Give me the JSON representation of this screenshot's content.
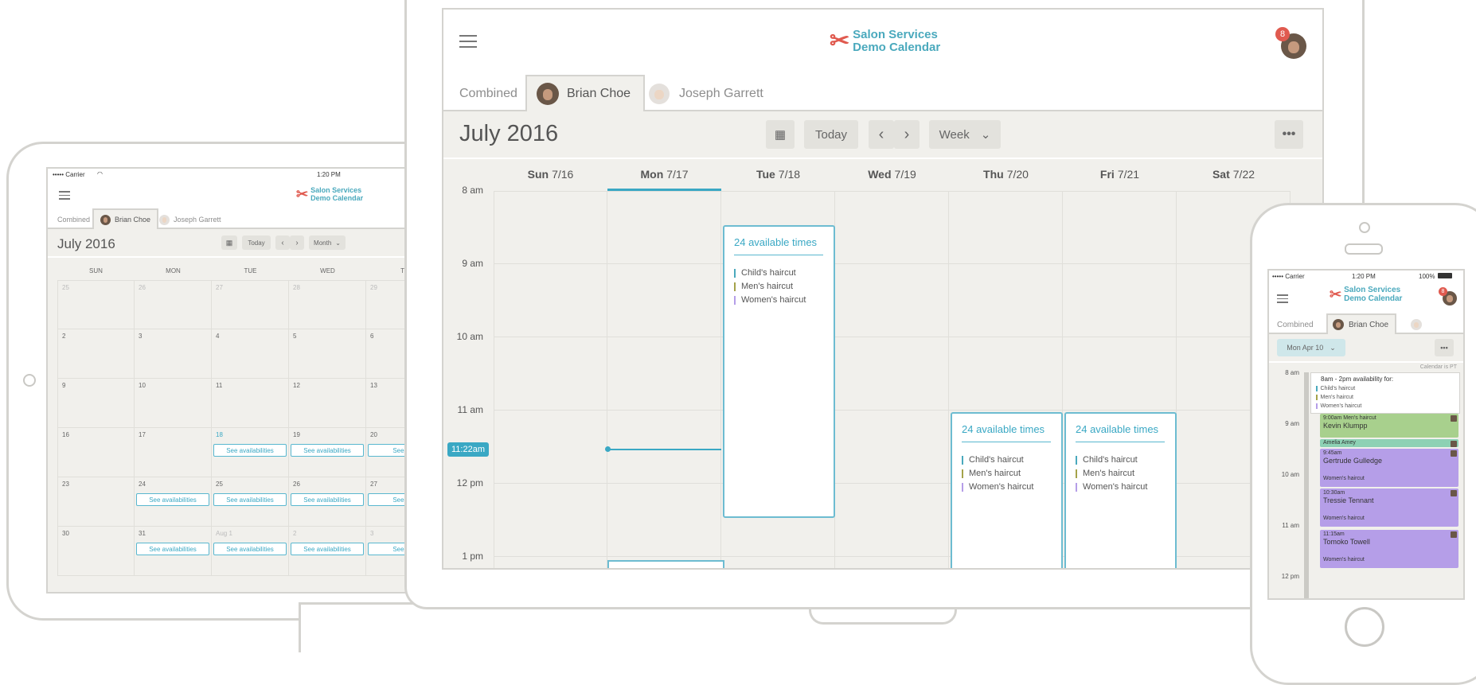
{
  "brand": {
    "line1": "Salon Services",
    "line2": "Demo Calendar",
    "accent": "#4aa9bd",
    "logo_color": "#e05a4f"
  },
  "notification_count": "8",
  "tabs": {
    "combined": "Combined",
    "brian": "Brian Choe",
    "joseph": "Joseph Garrett"
  },
  "services": {
    "child": "Child's haircut",
    "men": "Men's haircut",
    "women": "Women's haircut",
    "colors": [
      "#4aa9bd",
      "#a5a34a",
      "#b59ee8"
    ]
  },
  "laptop": {
    "title": "July 2016",
    "today_label": "Today",
    "view_label": "Week",
    "days": [
      {
        "dow": "Sun",
        "date": "7/16"
      },
      {
        "dow": "Mon",
        "date": "7/17"
      },
      {
        "dow": "Tue",
        "date": "7/18"
      },
      {
        "dow": "Wed",
        "date": "7/19"
      },
      {
        "dow": "Thu",
        "date": "7/20"
      },
      {
        "dow": "Fri",
        "date": "7/21"
      },
      {
        "dow": "Sat",
        "date": "7/22"
      }
    ],
    "times": [
      "8 am",
      "9 am",
      "10 am",
      "11 am",
      "12 pm",
      "1 pm"
    ],
    "now_label": "11:22am",
    "avail_label": "24 available times"
  },
  "tablet": {
    "status": {
      "carrier": "••••• Carrier",
      "time": "1:20 PM"
    },
    "title": "July 2016",
    "today_label": "Today",
    "view_label": "Month",
    "weekdays": [
      "SUN",
      "MON",
      "TUE",
      "WED",
      "TH"
    ],
    "weeks": [
      [
        "25",
        "26",
        "27",
        "28",
        "29"
      ],
      [
        "2",
        "3",
        "4",
        "5",
        "6"
      ],
      [
        "9",
        "10",
        "11",
        "12",
        "13"
      ],
      [
        "16",
        "17",
        "18",
        "19",
        "20"
      ],
      [
        "23",
        "24",
        "25",
        "26",
        "27"
      ],
      [
        "30",
        "31",
        "Aug 1",
        "2",
        "3"
      ]
    ],
    "see_label": "See availabilities",
    "see_label_cut": "See ava"
  },
  "phone": {
    "status": {
      "carrier": "••••• Carrier",
      "time": "1:20 PM",
      "battery": "100%"
    },
    "date_label": "Mon Apr 10",
    "calendar_note": "Calendar is PT",
    "times": [
      "8 am",
      "9 am",
      "10 am",
      "11 am",
      "12 pm"
    ],
    "availability_header": "8am - 2pm availability for:",
    "appointments": [
      {
        "time": "9:00am Men's haircut",
        "name": "Kevin Klumpp",
        "service": "",
        "color": "#a8d08d"
      },
      {
        "time": "",
        "name": "Amelia Amey",
        "service": "",
        "color": "#8dd1b4"
      },
      {
        "time": "9:45am",
        "name": "Gertrude Gulledge",
        "service": "Women's haircut",
        "color": "#b59ee8"
      },
      {
        "time": "10:30am",
        "name": "Tressie Tennant",
        "service": "Women's haircut",
        "color": "#b59ee8"
      },
      {
        "time": "11:15am",
        "name": "Tomoko Towell",
        "service": "Women's haircut",
        "color": "#b59ee8"
      }
    ]
  }
}
